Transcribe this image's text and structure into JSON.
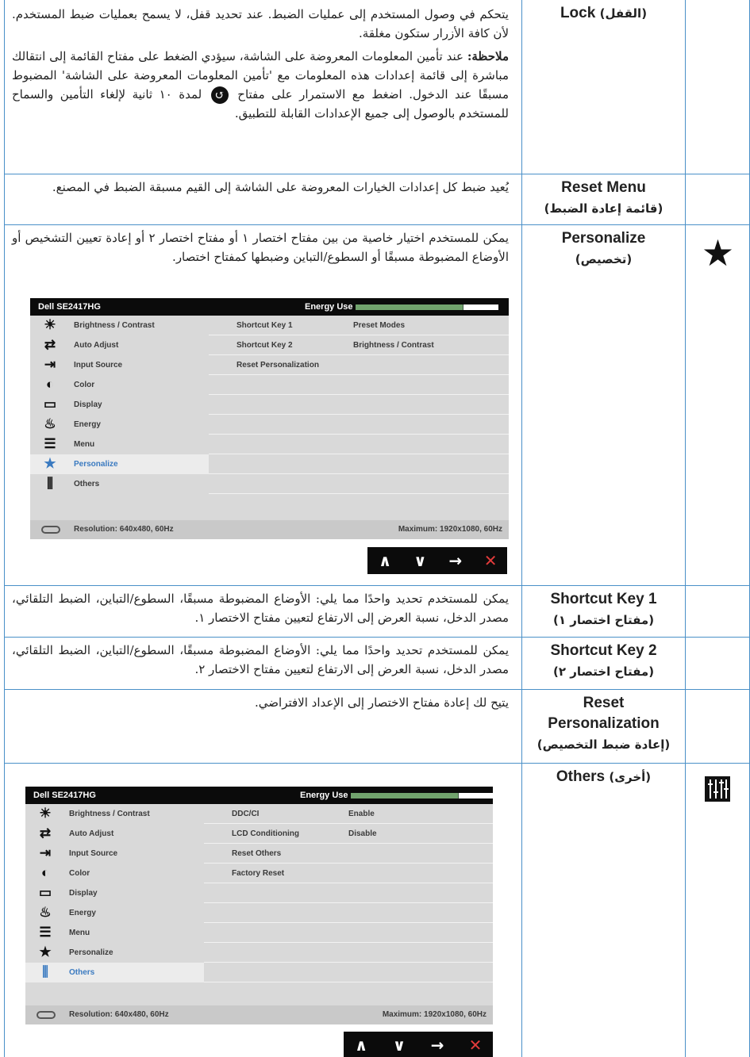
{
  "rows": {
    "lock": {
      "name_en": "Lock",
      "name_ar": "(القفل)",
      "p1": "يتحكم في وصول المستخدم إلى عمليات الضبط. عند تحديد قفل، لا يسمح بعمليات ضبط المستخدم. لأن كافة الأزرار ستكون مغلقة.",
      "note_label": "ملاحظة:",
      "note_a": "عند تأمين المعلومات المعروضة على الشاشة، سيؤدي الضغط على مفتاح القائمة إلى انتقالك مباشرة إلى قائمة إعدادات هذه المعلومات مع 'تأمين المعلومات المعروضة على الشاشة' المضبوط مسبقًا عند الدخول. اضغط مع الاستمرار على مفتاح",
      "note_b": "لمدة ١٠ ثانية لإلغاء التأمين والسماح للمستخدم بالوصول إلى جميع الإعدادات القابلة للتطبيق."
    },
    "reset_menu": {
      "name_en": "Reset Menu",
      "name_ar": "(قائمة إعادة الضبط)",
      "desc": "يُعيد ضبط كل إعدادات الخيارات المعروضة على الشاشة إلى القيم مسبقة الضبط في المصنع."
    },
    "personalize": {
      "name_en": "Personalize",
      "name_ar": "(تخصيص)",
      "desc": "يمكن للمستخدم اختيار خاصية من بين مفتاح اختصار ١ أو مفتاح اختصار ٢ أو إعادة تعيين التشخيص أو الأوضاع المضبوطة مسبقًا أو السطوع/التباين وضبطها كمفتاح اختصار.",
      "icon": "star-icon"
    },
    "shortcut1": {
      "name_en": "Shortcut Key 1",
      "name_ar": "(مفتاح اختصار ١)",
      "desc": "يمكن للمستخدم تحديد واحدًا مما يلي: الأوضاع المضبوطة مسبقًا، السطوع/التباين، الضبط التلقائي، مصدر الدخل، نسبة العرض إلى الارتفاع لتعيين مفتاح الاختصار ١."
    },
    "shortcut2": {
      "name_en": "Shortcut Key 2",
      "name_ar": "(مفتاح اختصار ٢)",
      "desc": "يمكن للمستخدم تحديد واحدًا مما يلي: الأوضاع المضبوطة مسبقًا، السطوع/التباين، الضبط التلقائي، مصدر الدخل، نسبة العرض إلى الارتفاع لتعيين مفتاح الاختصار ٢."
    },
    "reset_personalization": {
      "name_en_1": "Reset",
      "name_en_2": "Personalization",
      "name_ar": "(إعادة ضبط التخصيص)",
      "desc": "يتيح لك إعادة مفتاح الاختصار إلى الإعداد الافتراضي."
    },
    "others": {
      "name_en": "Others",
      "name_ar": "(أخرى)",
      "icon": "others-sliders-icon"
    }
  },
  "osd_common": {
    "model": "Dell SE2417HG",
    "energy_label": "Energy Use",
    "energy_level_fraction": 0.75,
    "menu_items": [
      {
        "label": "Brightness / Contrast",
        "icon": "brightness-icon"
      },
      {
        "label": "Auto Adjust",
        "icon": "auto-adjust-icon"
      },
      {
        "label": "Input Source",
        "icon": "input-source-icon"
      },
      {
        "label": "Color",
        "icon": "color-icon"
      },
      {
        "label": "Display",
        "icon": "display-icon"
      },
      {
        "label": "Energy",
        "icon": "energy-icon"
      },
      {
        "label": "Menu",
        "icon": "menu-icon"
      },
      {
        "label": "Personalize",
        "icon": "star-icon"
      },
      {
        "label": "Others",
        "icon": "others-sliders-icon"
      }
    ],
    "resolution": "Resolution: 640x480, 60Hz",
    "maximum": "Maximum: 1920x1080, 60Hz",
    "nav": [
      "∧",
      "∨",
      "→",
      "✕"
    ]
  },
  "osd_personalize": {
    "selected": "Personalize",
    "rows": [
      {
        "label": "Shortcut Key 1",
        "value": "Preset Modes"
      },
      {
        "label": "Shortcut Key 2",
        "value": "Brightness / Contrast"
      },
      {
        "label": "Reset Personalization",
        "value": ""
      }
    ]
  },
  "osd_others": {
    "selected": "Others",
    "rows": [
      {
        "label": "DDC/CI",
        "value": "Enable"
      },
      {
        "label": "LCD Conditioning",
        "value": "Disable"
      },
      {
        "label": "Reset Others",
        "value": ""
      },
      {
        "label": "Factory Reset",
        "value": ""
      }
    ]
  }
}
